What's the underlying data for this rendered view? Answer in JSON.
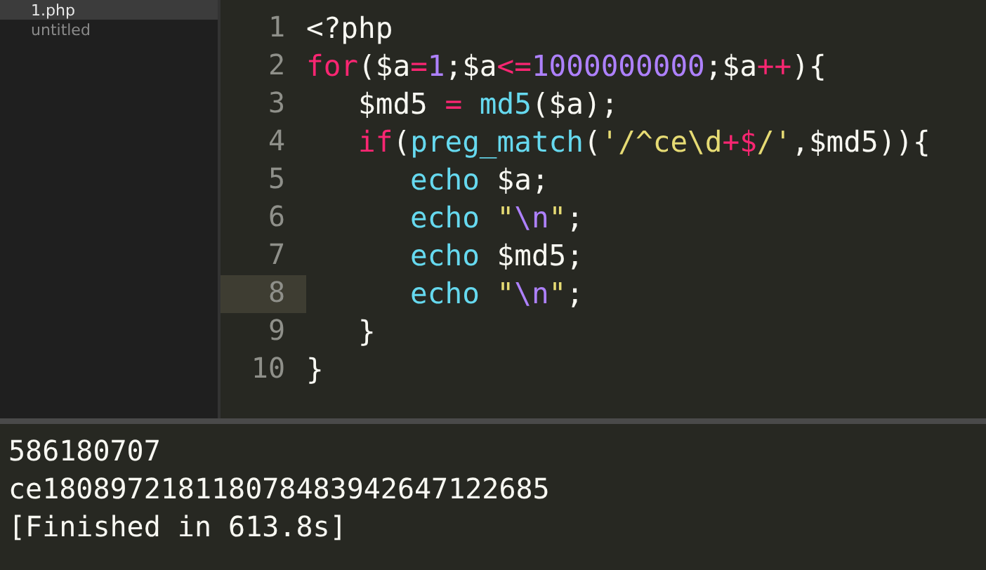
{
  "sidebar": {
    "files": [
      {
        "label": "1.php",
        "selected": true
      },
      {
        "label": "untitled",
        "selected": false
      }
    ]
  },
  "editor": {
    "lines": [
      {
        "number": "1",
        "current": false,
        "tokens": [
          {
            "kind": "plain",
            "text": "<?php"
          }
        ]
      },
      {
        "number": "2",
        "current": false,
        "tokens": [
          {
            "kind": "keyword",
            "text": "for"
          },
          {
            "kind": "plain",
            "text": "($a"
          },
          {
            "kind": "keyword",
            "text": "="
          },
          {
            "kind": "number",
            "text": "1"
          },
          {
            "kind": "plain",
            "text": ";$a"
          },
          {
            "kind": "keyword",
            "text": "<="
          },
          {
            "kind": "number",
            "text": "1000000000"
          },
          {
            "kind": "plain",
            "text": ";$a"
          },
          {
            "kind": "keyword",
            "text": "++"
          },
          {
            "kind": "plain",
            "text": "){"
          }
        ]
      },
      {
        "number": "3",
        "current": false,
        "tokens": [
          {
            "kind": "plain",
            "text": "   $md5 "
          },
          {
            "kind": "keyword",
            "text": "="
          },
          {
            "kind": "func",
            "text": " md5"
          },
          {
            "kind": "plain",
            "text": "($a);"
          }
        ]
      },
      {
        "number": "4",
        "current": false,
        "tokens": [
          {
            "kind": "keyword",
            "text": "   if"
          },
          {
            "kind": "plain",
            "text": "("
          },
          {
            "kind": "func",
            "text": "preg_match"
          },
          {
            "kind": "plain",
            "text": "("
          },
          {
            "kind": "string",
            "text": "'/^ce\\d"
          },
          {
            "kind": "keyword",
            "text": "+$"
          },
          {
            "kind": "string",
            "text": "/'"
          },
          {
            "kind": "plain",
            "text": ",$md5)){"
          }
        ]
      },
      {
        "number": "5",
        "current": false,
        "tokens": [
          {
            "kind": "func",
            "text": "      echo"
          },
          {
            "kind": "plain",
            "text": " $a;"
          }
        ]
      },
      {
        "number": "6",
        "current": false,
        "tokens": [
          {
            "kind": "func",
            "text": "      echo"
          },
          {
            "kind": "string",
            "text": " \""
          },
          {
            "kind": "number",
            "text": "\\n"
          },
          {
            "kind": "string",
            "text": "\""
          },
          {
            "kind": "plain",
            "text": ";"
          }
        ]
      },
      {
        "number": "7",
        "current": false,
        "tokens": [
          {
            "kind": "func",
            "text": "      echo"
          },
          {
            "kind": "plain",
            "text": " $md5;"
          }
        ]
      },
      {
        "number": "8",
        "current": true,
        "tokens": [
          {
            "kind": "func",
            "text": "      echo"
          },
          {
            "kind": "string",
            "text": " \""
          },
          {
            "kind": "number",
            "text": "\\n"
          },
          {
            "kind": "string",
            "text": "\""
          },
          {
            "kind": "plain",
            "text": ";"
          }
        ]
      },
      {
        "number": "9",
        "current": false,
        "tokens": [
          {
            "kind": "plain",
            "text": "   }"
          }
        ]
      },
      {
        "number": "10",
        "current": false,
        "tokens": [
          {
            "kind": "plain",
            "text": "}"
          }
        ]
      }
    ]
  },
  "output": {
    "lines": [
      "586180707",
      "ce180897218118078483942647122685",
      "[Finished in 613.8s]"
    ]
  }
}
